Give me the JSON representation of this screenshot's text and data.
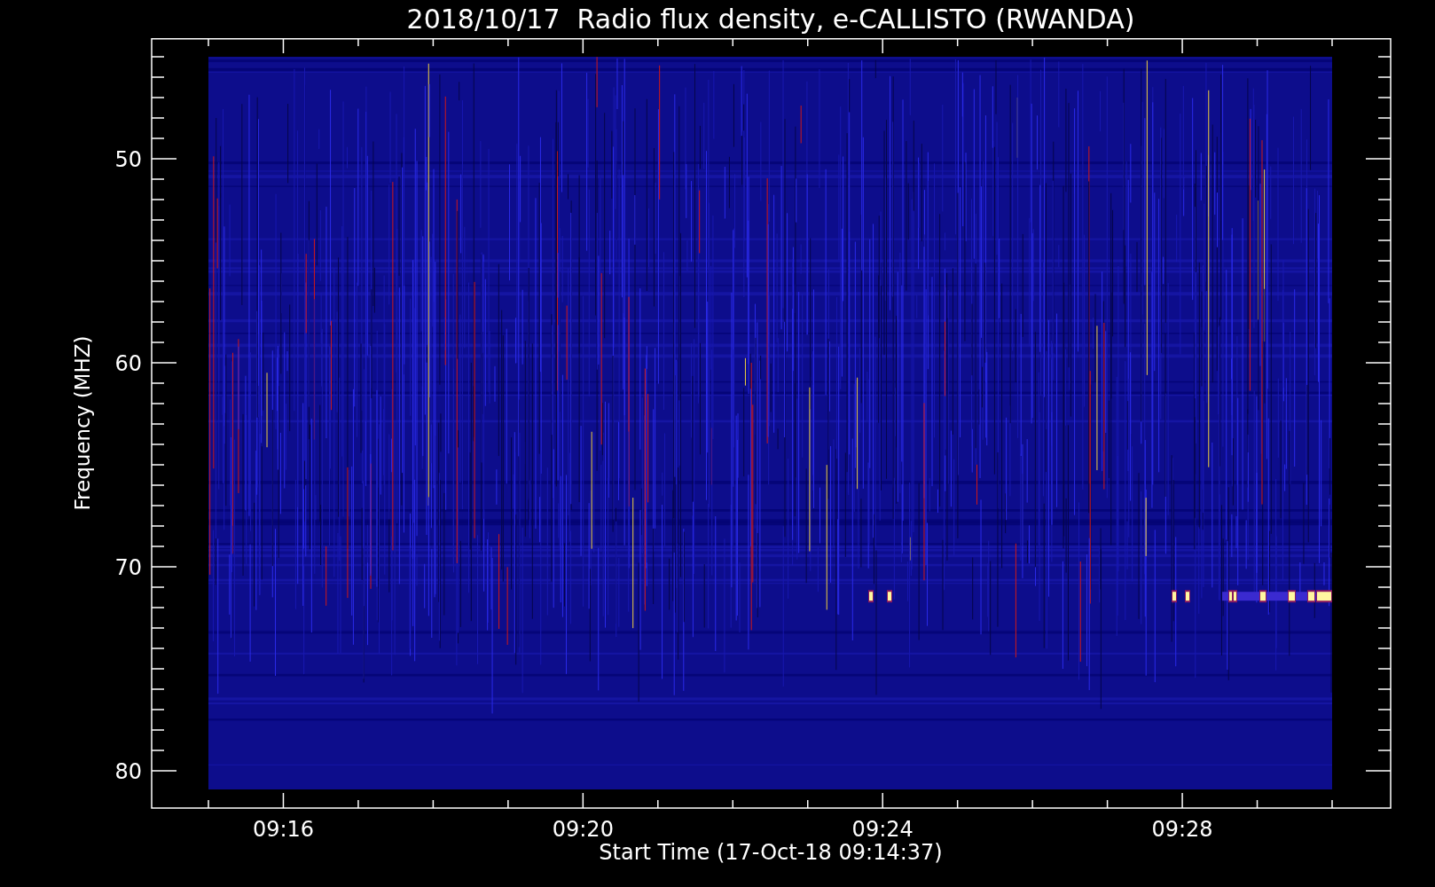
{
  "title": "2018/10/17  Radio flux density, e-CALLISTO (RWANDA)",
  "y_axis": {
    "label": "Frequency (MHZ)",
    "tick_labels": [
      "50",
      "60",
      "70",
      "80"
    ]
  },
  "x_axis": {
    "label": "Start Time (17-Oct-18 09:14:37)",
    "tick_labels": [
      "09:16",
      "09:20",
      "09:24",
      "09:28"
    ]
  }
}
